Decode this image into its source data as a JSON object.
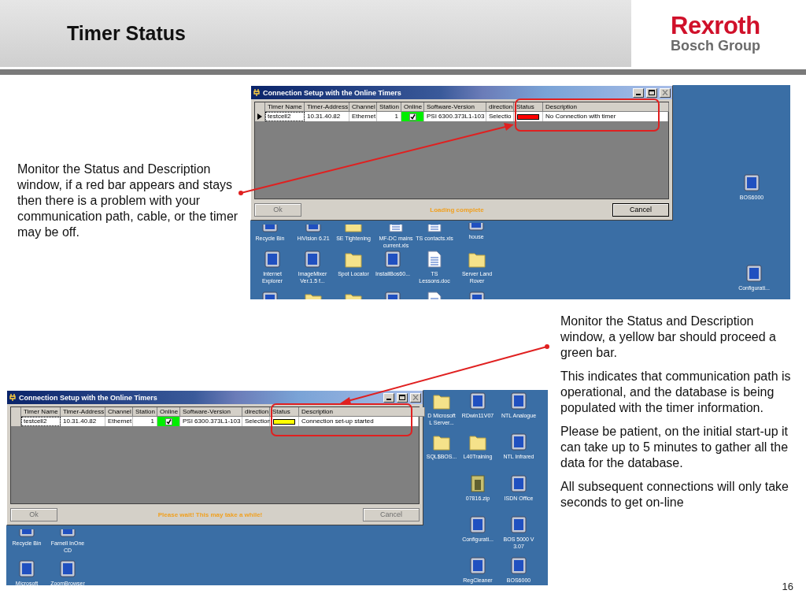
{
  "slide": {
    "title": "Timer Status",
    "logo": {
      "brand": "Rexroth",
      "group": "Bosch Group"
    },
    "page_number": "16"
  },
  "screenshots": [
    {
      "dialog": {
        "title": "Connection Setup with the Online Timers",
        "columns": [
          "Timer Name",
          "Timer-Address",
          "Channel",
          "Station",
          "Online",
          "Software-Version",
          "direction",
          "Status",
          "Description"
        ],
        "row": {
          "current": true,
          "timer_name": "testcell2",
          "address": "10.31.40.82",
          "channel": "Ethernet",
          "station": "1",
          "online": {
            "checked": true
          },
          "software_version": "PSI 6300.373L1-103",
          "direction": "Selectio",
          "status": {
            "color": "#ff0000"
          },
          "description": "No Connection with timer"
        },
        "ok_button": {
          "label": "Ok",
          "disabled": true
        },
        "message": "Loading complete",
        "cancel_button": {
          "label": "Cancel",
          "disabled": false
        }
      },
      "desktop_icons": [
        {
          "label": "Recycle Bin",
          "kind": "app"
        },
        {
          "label": "HiVision 6.21",
          "kind": "app"
        },
        {
          "label": "SE Tightening",
          "kind": "folder"
        },
        {
          "label": "MF-DC mains current.xls",
          "kind": "document"
        },
        {
          "label": "TS contacts.xls",
          "kind": "document"
        },
        {
          "label": "house",
          "kind": "app"
        },
        {
          "label": "Internet Explorer",
          "kind": "app"
        },
        {
          "label": "ImageMixer Ver.1.5 f...",
          "kind": "app"
        },
        {
          "label": "Spot Locator",
          "kind": "folder"
        },
        {
          "label": "InstallBos60...",
          "kind": "app"
        },
        {
          "label": "TS Lessons.doc",
          "kind": "document"
        },
        {
          "label": "Server Land Rover",
          "kind": "folder"
        },
        {
          "kind": "app"
        },
        {
          "kind": "folder"
        },
        {
          "kind": "folder"
        },
        {
          "kind": "app"
        },
        {
          "kind": "document"
        },
        {
          "kind": "app"
        },
        {
          "label": "BOS6000",
          "kind": "app"
        },
        {
          "label": "Configurati...",
          "kind": "app"
        }
      ]
    },
    {
      "dialog": {
        "title": "Connection Setup with the Online Timers",
        "columns": [
          "Timer Name",
          "Timer-Address",
          "Channel",
          "Station",
          "Online",
          "Software-Version",
          "direction",
          "Status",
          "Description"
        ],
        "row": {
          "current": false,
          "timer_name": "testcell2",
          "address": "10.31.40.82",
          "channel": "Ethernet",
          "station": "1",
          "online": {
            "checked": true
          },
          "software_version": "PSI 6300.373L1-103",
          "direction": "Selection",
          "status": {
            "color": "#ffff00"
          },
          "description": "Connection set-up started"
        },
        "ok_button": {
          "label": "Ok",
          "disabled": true
        },
        "message": "Please wait! This may take a while!",
        "cancel_button": {
          "label": "Cancel",
          "disabled": true
        }
      },
      "desktop_icons": [
        {
          "label": "D Microsoft L Server...",
          "kind": "folder"
        },
        {
          "label": "SQL$BOS...",
          "kind": "folder"
        },
        {
          "label": "RDwin11V07",
          "kind": "app"
        },
        {
          "label": "L40Training",
          "kind": "folder"
        },
        {
          "label": "07816.zip",
          "kind": "archive"
        },
        {
          "label": "Configurati...",
          "kind": "app"
        },
        {
          "label": "RegCleaner",
          "kind": "app"
        },
        {
          "label": "NTL Analogue",
          "kind": "app"
        },
        {
          "label": "NTL Infrared",
          "kind": "app"
        },
        {
          "label": "ISDN Office",
          "kind": "app"
        },
        {
          "label": "BOS 5000 V 3.07",
          "kind": "app"
        },
        {
          "label": "BOS6000",
          "kind": "app"
        },
        {
          "label": "Recycle Bin",
          "kind": "app"
        },
        {
          "label": "Farnell InOne CD",
          "kind": "app"
        },
        {
          "label": "Microsoft",
          "kind": "app"
        },
        {
          "label": "ZoomBrowser",
          "kind": "app"
        }
      ]
    }
  ],
  "notes": [
    {
      "paragraphs": [
        "Monitor the Status and Description window, if a red bar appears and stays then there is a problem with your communication path, cable, or the timer may be off."
      ]
    },
    {
      "paragraphs": [
        "Monitor the Status and Description window, a yellow bar should proceed a green bar.",
        "This indicates that communication path is operational, and the database is being populated with the timer information.",
        "Please be patient, on the initial start-up it can take up to 5 minutes to gather all the data for the database.",
        "All subsequent connections will only take seconds to get on-line"
      ]
    }
  ]
}
